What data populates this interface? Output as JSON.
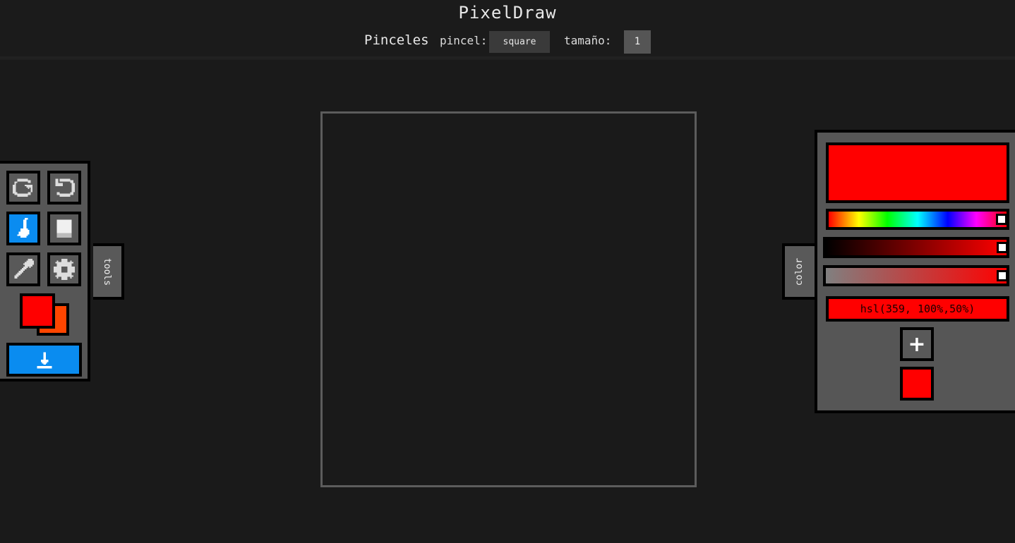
{
  "app": {
    "title": "PixelDraw"
  },
  "brushes": {
    "heading": "Pinceles",
    "brush_label": "pincel:",
    "brush_value": "square",
    "size_label": "tamaño:",
    "size_value": "1"
  },
  "tools": {
    "tab_label": "tools",
    "buttons": [
      {
        "name": "redo",
        "icon": "redo-icon"
      },
      {
        "name": "undo",
        "icon": "undo-icon"
      },
      {
        "name": "brush",
        "icon": "brush-icon",
        "active": true
      },
      {
        "name": "eraser",
        "icon": "eraser-icon"
      },
      {
        "name": "eyedropper",
        "icon": "eyedropper-icon"
      },
      {
        "name": "settings",
        "icon": "gear-icon"
      }
    ],
    "primary_color": "#ff0000",
    "secondary_color": "#ff4500",
    "download_icon": "download-icon"
  },
  "color": {
    "tab_label": "color",
    "current": "#ff0000",
    "hue": 359,
    "saturation_percent": 100,
    "lightness_percent": 50,
    "value_text": "hsl(359, 100%,50%)",
    "add_label": "+",
    "saved_colors": [
      "#ff0000"
    ]
  },
  "accent": "#0a8cf0"
}
